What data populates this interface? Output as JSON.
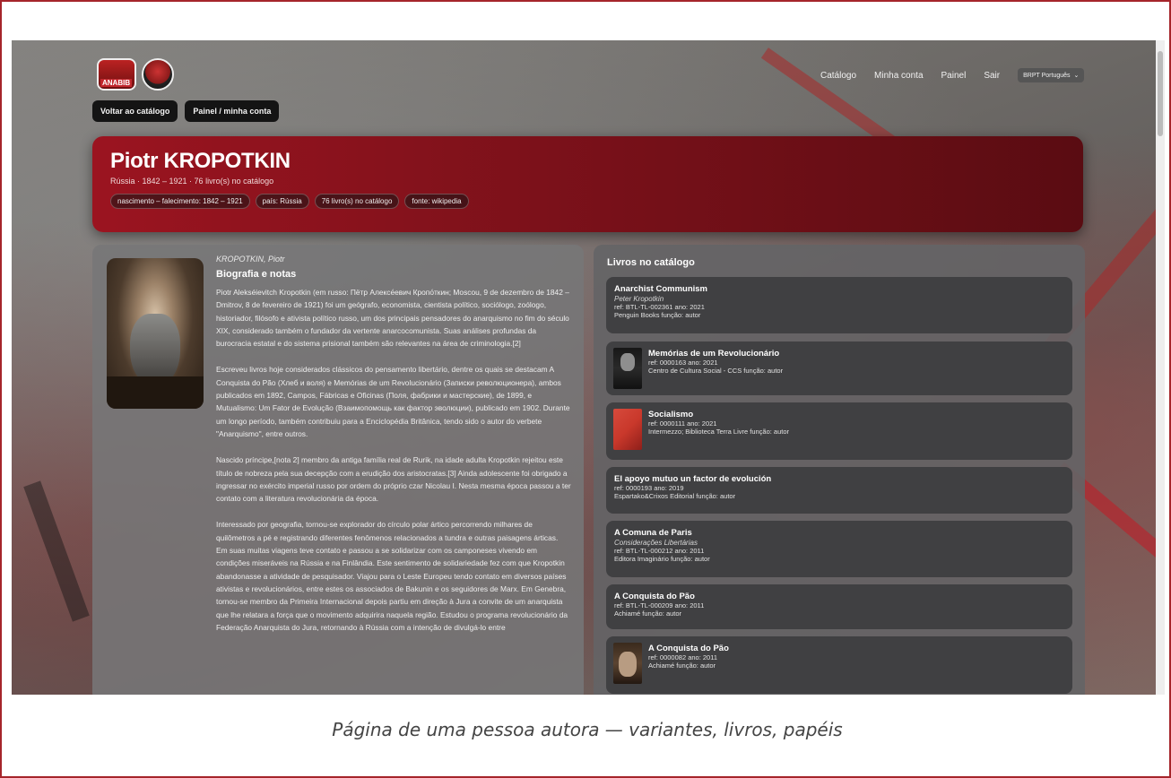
{
  "nav": {
    "links": [
      "Catálogo",
      "Minha conta",
      "Painel",
      "Sair"
    ],
    "language": "BRPT Português"
  },
  "actions": {
    "back": "Voltar ao catálogo",
    "panel": "Painel / minha conta"
  },
  "author": {
    "name": "Piotr KROPOTKIN",
    "summary": "Rússia · 1842 – 1921 · 76 livro(s) no catálogo",
    "chips": [
      "nascimento – falecimento: 1842 – 1921",
      "país: Rússia",
      "76 livro(s) no catálogo",
      "fonte: wikipedia"
    ]
  },
  "bio": {
    "variant": "KROPOTKIN, Piotr",
    "title": "Biografia e notas",
    "paragraphs": [
      "Piotr Alekséievitch Kropotkin (em russo: Пётр Алексе́евич Кропо́ткин; Moscou, 9 de dezembro de 1842 – Dmitrov, 8 de fevereiro de 1921) foi um geógrafo, economista, cientista político, sociólogo, zoólogo, historiador, filósofo e ativista político russo, um dos principais pensadores do anarquismo no fim do século XIX, considerado também o fundador da vertente anarcocomunista. Suas análises profundas da burocracia estatal e do sistema prisional também são relevantes na área de criminologia.[2]",
      "Escreveu livros hoje considerados clássicos do pensamento libertário, dentre os quais se destacam A Conquista do Pão (Хлеб и воля) e Memórias de um Revolucionário (Записки революционера), ambos publicados em 1892, Campos, Fábricas e Oficinas (Поля, фабрики и мастерские), de 1899, e Mutualismo: Um Fator de Evolução (Взаимопомощь как фактор эволюции), publicado em 1902. Durante um longo período, também contribuiu para a Enciclopédia Britânica, tendo sido o autor do verbete \"Anarquismo\", entre outros.",
      "Nascido príncipe,[nota 2] membro da antiga família real de Rurik, na idade adulta Kropotkin rejeitou este título de nobreza pela sua decepção com a erudição dos aristocratas.[3] Ainda adolescente foi obrigado a ingressar no exército imperial russo por ordem do próprio czar Nicolau I. Nesta mesma época passou a ter contato com a literatura revolucionária da época.",
      "Interessado por geografia, tornou-se explorador do círculo polar ártico percorrendo milhares de quilômetros a pé e registrando diferentes fenômenos relacionados a tundra e outras paisagens árticas. Em suas muitas viagens teve contato e passou a se solidarizar com os camponeses vivendo em condições miseráveis na Rússia e na Finlândia. Este sentimento de solidariedade fez com que Kropotkin abandonasse a atividade de pesquisador. Viajou para o Leste Europeu tendo contato em diversos países ativistas e revolucionários, entre estes os associados de Bakunin e os seguidores de Marx. Em Genebra, tornou-se membro da Primeira Internacional depois partiu em direção à Jura a convite de um anarquista que lhe relatara a força que o movimento adquirira naquela região. Estudou o programa revolucionário da Federação Anarquista do Jura, retornando à Rússia com a intenção de divulgá-lo entre"
    ]
  },
  "books": {
    "title": "Livros no catálogo",
    "items": [
      {
        "title": "Anarchist Communism",
        "subtitle": "Peter Kropotkin",
        "line1": "ref: BTL-TL-002361   ano: 2021",
        "line2": "Penguin Books   função: autor"
      },
      {
        "title": "Memórias de um Revolucionário",
        "line1": "ref: 0000163   ano: 2021",
        "line2": "Centro de Cultura Social - CCS   função: autor"
      },
      {
        "title": "Socialismo",
        "line1": "ref: 0000111   ano: 2021",
        "line2": "Intermezzo; Biblioteca Terra Livre   função: autor",
        "cover_text": "SOCI ALIS MO"
      },
      {
        "title": "El apoyo mutuo un factor de evolución",
        "line1": "ref: 0000193   ano: 2019",
        "line2": "Espartako&Crixos Editorial   função: autor"
      },
      {
        "title": "A Comuna de Paris",
        "subtitle": "Considerações Libertárias",
        "line1": "ref: BTL-TL-000212   ano: 2011",
        "line2": "Editora Imaginário   função: autor"
      },
      {
        "title": "A Conquista do Pão",
        "line1": "ref: BTL-TL-000209   ano: 2011",
        "line2": "Achiamé   função: autor"
      },
      {
        "title": "A Conquista do Pão",
        "line1": "ref: 0000082   ano: 2011",
        "line2": "Achiamé   função: autor"
      }
    ]
  },
  "caption": "Página de uma pessoa autora — variantes, livros, papéis"
}
